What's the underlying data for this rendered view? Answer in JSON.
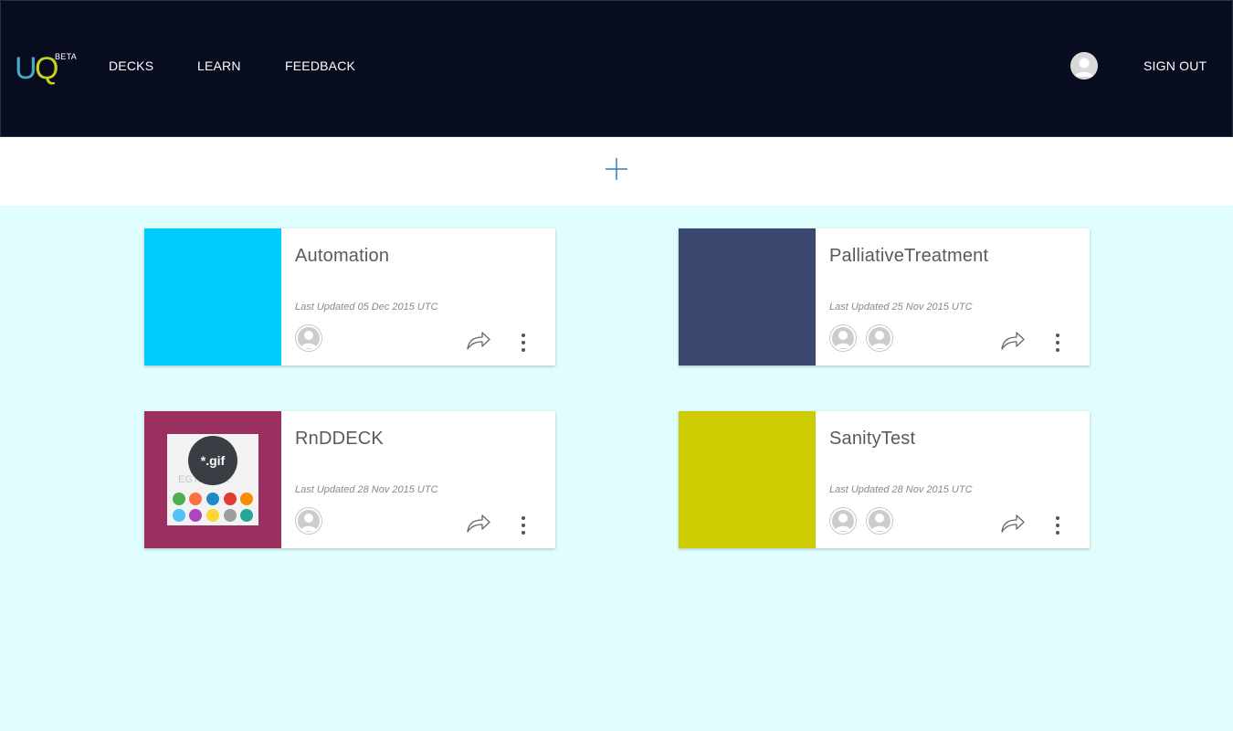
{
  "header": {
    "logo": {
      "u": "U",
      "q": "Q",
      "beta": "BETA"
    },
    "nav": [
      {
        "label": "DECKS"
      },
      {
        "label": "LEARN"
      },
      {
        "label": "FEEDBACK"
      }
    ],
    "sign_out": "SIGN OUT"
  },
  "cards": [
    {
      "title": "Automation",
      "updated": "Last Updated 05 Dec 2015 UTC",
      "thumb_color": "#00ccff",
      "collaborators": 1
    },
    {
      "title": "PalliativeTreatment",
      "updated": "Last Updated 25 Nov 2015 UTC",
      "thumb_color": "#3a4870",
      "collaborators": 2
    },
    {
      "title": "RnDDECK",
      "updated": "Last Updated 28 Nov 2015 UTC",
      "thumb_color": "#9b3060",
      "thumb_image": {
        "badge": "*.gif",
        "watermark": "EGTourBox"
      },
      "collaborators": 1
    },
    {
      "title": "SanityTest",
      "updated": "Last Updated 28 Nov 2015 UTC",
      "thumb_color": "#cccc00",
      "collaborators": 2
    }
  ],
  "colors": {
    "header_bg": "#080c1f",
    "page_bg": "#e0fefe",
    "accent": "#2f7fc1",
    "logo_u": "#4aa7c9",
    "logo_q": "#c9d21a"
  },
  "icons": {
    "add": "plus-icon",
    "share": "share-arrow-icon",
    "more": "more-vertical-icon",
    "avatar": "user-silhouette-icon"
  }
}
